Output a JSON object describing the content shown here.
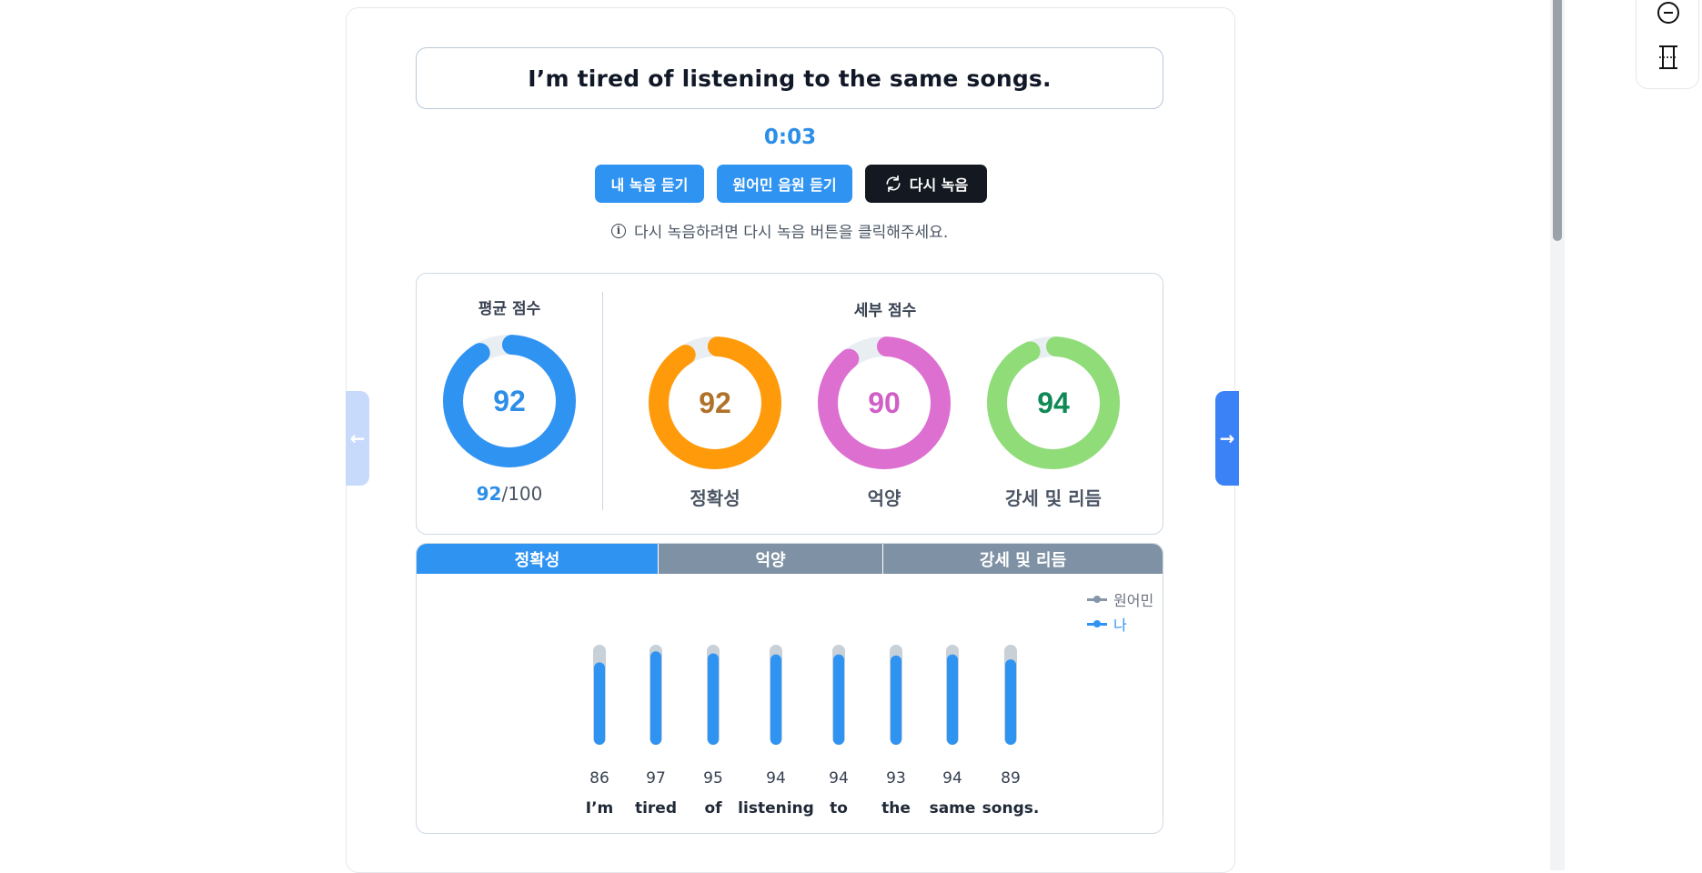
{
  "sentence": "I’m tired of listening to the same songs.",
  "timer": "0:03",
  "buttons": {
    "my_recording": "내 녹음 듣기",
    "native_audio": "원어민 음원 듣기",
    "rerecord": "다시 녹음"
  },
  "hint": "다시 녹음하려면 다시 녹음 버튼을 클릭해주세요.",
  "scores": {
    "average_heading": "평균 점수",
    "detail_heading": "세부 점수",
    "average": {
      "value": "92",
      "max_label": "/100",
      "percent": 92,
      "color": "#2f93f2",
      "text_color": "#2d8ee8"
    },
    "details": [
      {
        "label": "정확성",
        "value": "92",
        "percent": 92,
        "color": "#ff9a0a",
        "text_color": "#b0712a"
      },
      {
        "label": "억양",
        "value": "90",
        "percent": 90,
        "color": "#dd6fd0",
        "text_color": "#d05fc6"
      },
      {
        "label": "강세 및 리듬",
        "value": "94",
        "percent": 94,
        "color": "#90dc78",
        "text_color": "#0f8a55"
      }
    ]
  },
  "tabs": [
    {
      "label": "정확성",
      "active": true
    },
    {
      "label": "억양",
      "active": false
    },
    {
      "label": "강세 및 리듬",
      "active": false
    }
  ],
  "legend": [
    {
      "label": "원어민",
      "color": "#8496a8"
    },
    {
      "label": "나",
      "color": "#2f93f2"
    }
  ],
  "chart_data": {
    "type": "bar",
    "categories": [
      "I’m",
      "tired",
      "of",
      "listening",
      "to",
      "the",
      "same",
      "songs."
    ],
    "series": [
      {
        "name": "원어민",
        "values": [
          100,
          100,
          100,
          100,
          100,
          100,
          100,
          100
        ]
      },
      {
        "name": "나",
        "values": [
          86,
          97,
          95,
          94,
          94,
          93,
          94,
          89
        ]
      }
    ],
    "ylim": [
      0,
      100
    ],
    "data_labels": [
      "86",
      "97",
      "95",
      "94",
      "94",
      "93",
      "94",
      "89"
    ]
  },
  "nav": {
    "prev": "←",
    "next": "→"
  }
}
